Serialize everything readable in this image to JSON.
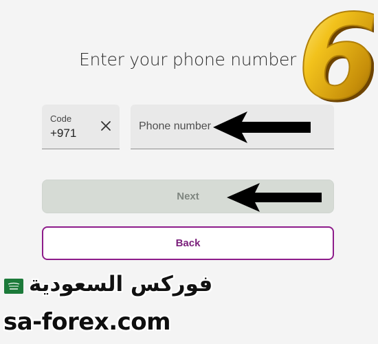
{
  "screen": {
    "title": "Enter your phone number"
  },
  "step_badge": {
    "number": "6",
    "color": "#d4a417"
  },
  "code_field": {
    "label": "Code",
    "value": "+971"
  },
  "phone_field": {
    "placeholder": "Phone number",
    "value": ""
  },
  "buttons": {
    "next_label": "Next",
    "back_label": "Back"
  },
  "watermark": {
    "arabic_name": "فوركس السعودية",
    "url": "sa-forex.com",
    "flag_icon": "saudi-flag-icon"
  },
  "colors": {
    "accent": "#8d1b8a",
    "next_button_bg": "#d6dbd5",
    "field_bg": "#e9e9e9",
    "arrow": "#000000"
  }
}
